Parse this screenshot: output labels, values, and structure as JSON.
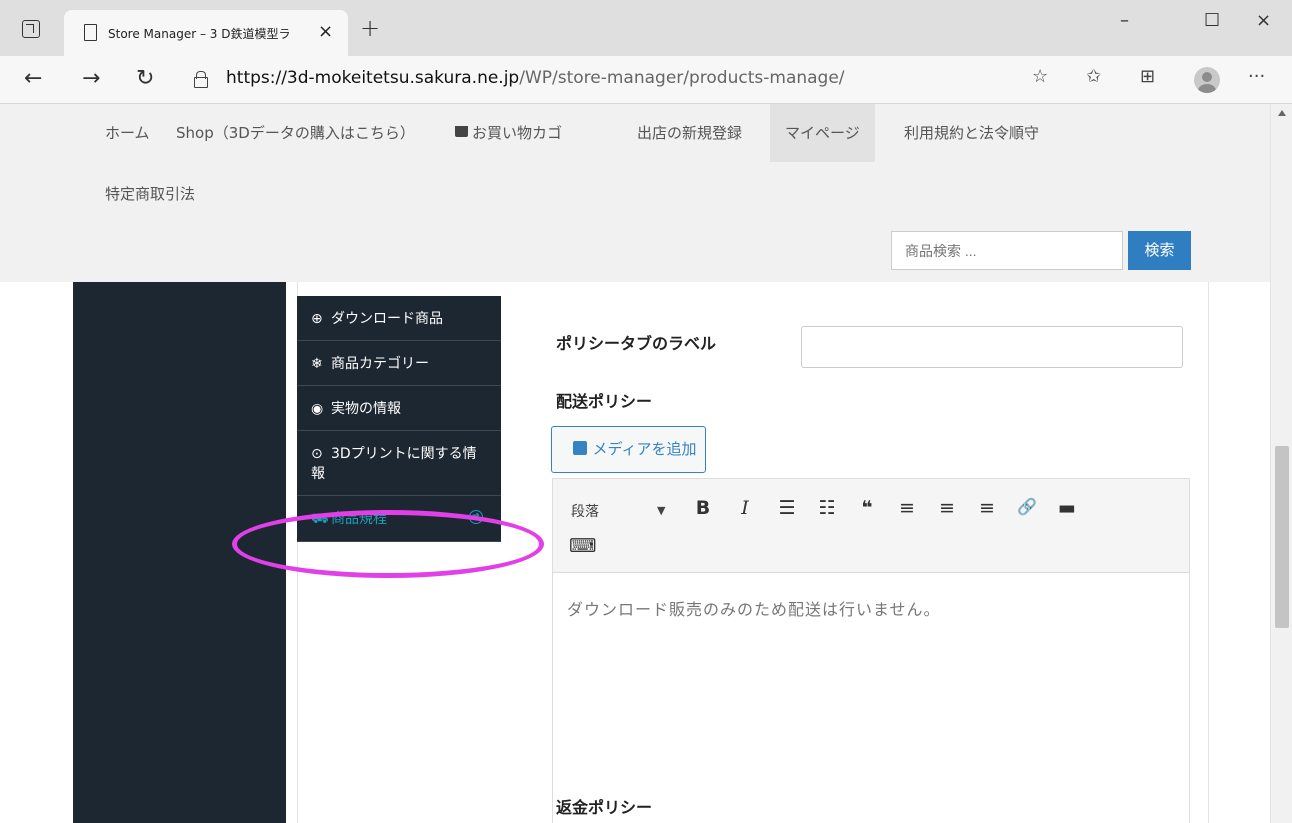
{
  "browser": {
    "tab_title": "Store Manager – 3 D鉄道模型ラ",
    "tab_close": "×",
    "new_tab": "+",
    "window_controls": {
      "minimize": "–",
      "maximize": "☐",
      "close": "×"
    },
    "nav": {
      "back": "←",
      "forward": "→",
      "refresh": "↻"
    },
    "url_host": "https://3d-mokeitetsu.sakura.ne.jp",
    "url_path": "/WP/store-manager/products-manage/",
    "toolbar_icons": [
      "favorite-add-icon",
      "favorites-icon",
      "collections-icon",
      "profile-icon",
      "more-icon"
    ],
    "more": "···"
  },
  "site_menu": {
    "items": [
      "ホーム",
      "Shop（3Dデータの購入はこちら）",
      "お買い物カゴ",
      "出店の新規登録",
      "マイページ",
      "利用規約と法令順守",
      "特定商取引法"
    ],
    "active_index": 4
  },
  "search": {
    "placeholder": "商品検索 ...",
    "button": "検索",
    "button_color": "#2f7ec1"
  },
  "product_nav": {
    "items": [
      {
        "icon": "download-icon",
        "glyph": "⊕",
        "label": "ダウンロード商品"
      },
      {
        "icon": "snowflake-icon",
        "glyph": "❄",
        "label": "商品カテゴリー"
      },
      {
        "icon": "target-icon",
        "glyph": "◉",
        "label": "実物の情報"
      },
      {
        "icon": "circle-dot-icon",
        "glyph": "⊙",
        "label": "3Dプリントに関する情報"
      },
      {
        "icon": "policy-icon",
        "glyph": "⛟",
        "label": "商品規程",
        "arrow": "➔"
      }
    ],
    "active_index": 4,
    "active_color": "#17a2b8",
    "highlight_color": "#e13fe7"
  },
  "form": {
    "policy_tab_label": "ポリシータブのラベル",
    "policy_tab_value": "",
    "shipping_policy_label": "配送ポリシー",
    "add_media": "メディアを追加",
    "format_select": "段落",
    "toolbar": {
      "caret": "▼",
      "bold": "B",
      "italic": "I",
      "bullet_list": "☰",
      "numbered_list": "☷",
      "blockquote": "❝",
      "align_left": "≡",
      "align_center": "≡",
      "align_right": "≡",
      "link": "🔗",
      "read_more": "▬",
      "keyboard": "⌨"
    },
    "shipping_policy_text": "ダウンロード販売のみのため配送は行いません。",
    "refund_policy_label": "返金ポリシー"
  }
}
